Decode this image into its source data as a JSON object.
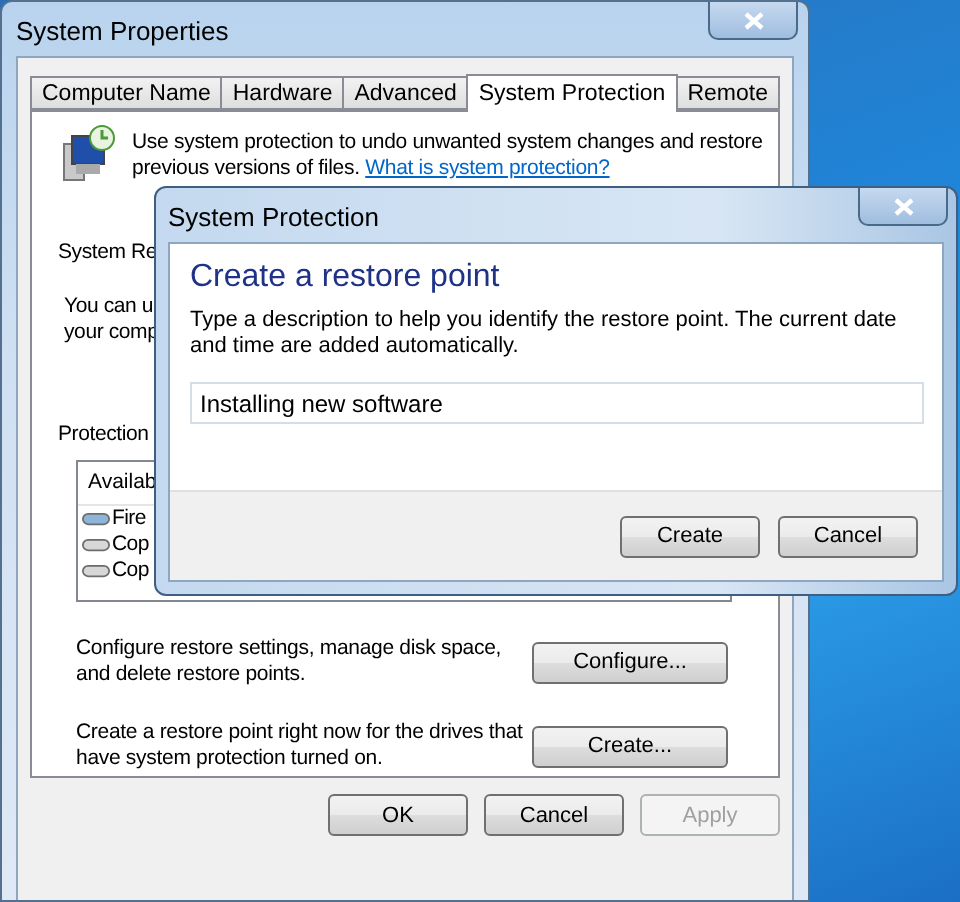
{
  "window": {
    "title": "System Properties"
  },
  "tabs": [
    {
      "label": "Computer Name",
      "selected": false
    },
    {
      "label": "Hardware",
      "selected": false
    },
    {
      "label": "Advanced",
      "selected": false
    },
    {
      "label": "System Protection",
      "selected": true
    },
    {
      "label": "Remote",
      "selected": false
    }
  ],
  "intro": {
    "text": "Use system protection to undo unwanted system changes and restore previous versions of files.",
    "link": "What is system protection?"
  },
  "restore_heading": "System Re",
  "restore_text": [
    "You can u",
    "your comp"
  ],
  "protection_label": "Protection",
  "drives": {
    "header": "Availab",
    "rows": [
      {
        "name": "Fire",
        "selected": true
      },
      {
        "name": "Cop",
        "selected": false
      },
      {
        "name": "Cop",
        "selected": false
      }
    ]
  },
  "actions": [
    {
      "text": "Configure restore settings, manage disk space, and delete restore points.",
      "button": "Configure..."
    },
    {
      "text": "Create a restore point right now for the drives that have system protection turned on.",
      "button": "Create..."
    }
  ],
  "buttons": [
    {
      "label": "OK",
      "disabled": false
    },
    {
      "label": "Cancel",
      "disabled": false
    },
    {
      "label": "Apply",
      "disabled": true
    }
  ],
  "dialog": {
    "title": "System Protection",
    "heading": "Create a restore point",
    "description": "Type a description to help you identify the restore point. The current date and time are added automatically.",
    "value": "Installing new software",
    "buttons": [
      "Create",
      "Cancel"
    ]
  }
}
